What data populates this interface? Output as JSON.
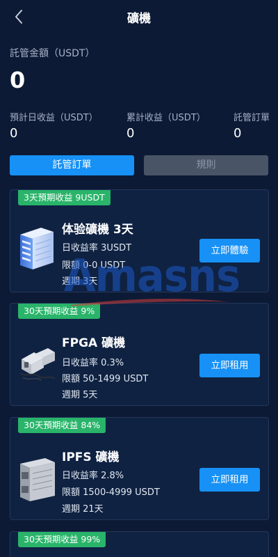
{
  "header": {
    "title": "礦機",
    "back_icon": "chevron-left-icon"
  },
  "summary": {
    "total_label": "託管金額（USDT）",
    "total_value": "0",
    "stats": [
      {
        "label": "預計日收益（USDT）",
        "value": "0"
      },
      {
        "label": "累計收益（USDT）",
        "value": "0"
      },
      {
        "label": "託管訂單",
        "value": "0"
      }
    ]
  },
  "buttons": {
    "orders": "託管訂單",
    "rules": "規則"
  },
  "cards": [
    {
      "badge": "3天預期收益 9USDT",
      "name": "体验礦機 3天",
      "daily": "日收益率 3USDT",
      "limit": "限額 0-0 USDT",
      "period": "週期 3天",
      "action": "立即體驗",
      "icon": "server-rack-icon"
    },
    {
      "badge": "30天預期收益 9%",
      "name": "FPGA 礦機",
      "daily": "日收益率 0.3%",
      "limit": "限額 50-1499 USDT",
      "period": "週期 5天",
      "action": "立即租用",
      "icon": "fpga-miner-icon"
    },
    {
      "badge": "30天預期收益 84%",
      "name": "IPFS 礦機",
      "daily": "日收益率 2.8%",
      "limit": "限額 1500-4999 USDT",
      "period": "週期 21天",
      "action": "立即租用",
      "icon": "ipfs-miner-icon"
    },
    {
      "badge": "30天預期收益 99%"
    }
  ],
  "watermark": "Amasns",
  "colors": {
    "background": "#0c1a35",
    "card": "#0f2242",
    "primary": "#1791f5",
    "badge": "#29b46a",
    "disabled": "#4a5467"
  }
}
